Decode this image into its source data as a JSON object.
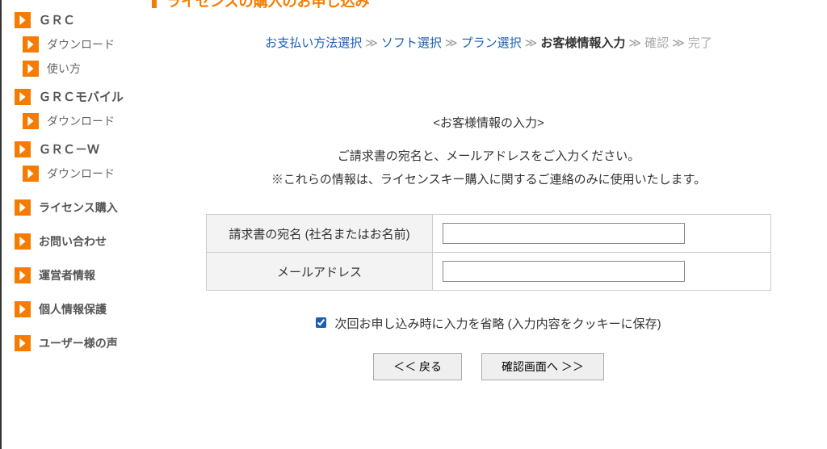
{
  "sidebar": {
    "sections": [
      {
        "heading": "ＧＲＣ",
        "subs": [
          "ダウンロード",
          "使い方"
        ]
      },
      {
        "heading": "ＧＲＣモバイル",
        "subs": [
          "ダウンロード"
        ]
      },
      {
        "heading": "ＧＲＣ－Ｗ",
        "subs": [
          "ダウンロード"
        ]
      }
    ],
    "items": [
      "ライセンス購入",
      "お問い合わせ",
      "運営者情報",
      "個人情報保護",
      "ユーザー様の声"
    ]
  },
  "main": {
    "page_title": "ライセンスの購入のお申し込み",
    "breadcrumb": {
      "steps": [
        "お支払い方法選択",
        "ソフト選択",
        "プラン選択",
        "お客様情報入力",
        "確認",
        "完了"
      ],
      "current_index": 3
    },
    "section_heading": "<お客様情報の入力>",
    "desc_line1": "ご請求書の宛名と、メールアドレスをご入力ください。",
    "desc_line2": "※これらの情報は、ライセンスキー購入に関するご連絡のみに使用いたします。",
    "form": {
      "label_name": "請求書の宛名 (社名またはお名前)",
      "value_name": "",
      "label_email": "メールアドレス",
      "value_email": ""
    },
    "checkbox_label": "次回お申し込み時に入力を省略 (入力内容をクッキーに保存)",
    "checkbox_checked": true,
    "btn_back": "＜＜ 戻る",
    "btn_confirm": "確認画面へ ＞＞"
  }
}
